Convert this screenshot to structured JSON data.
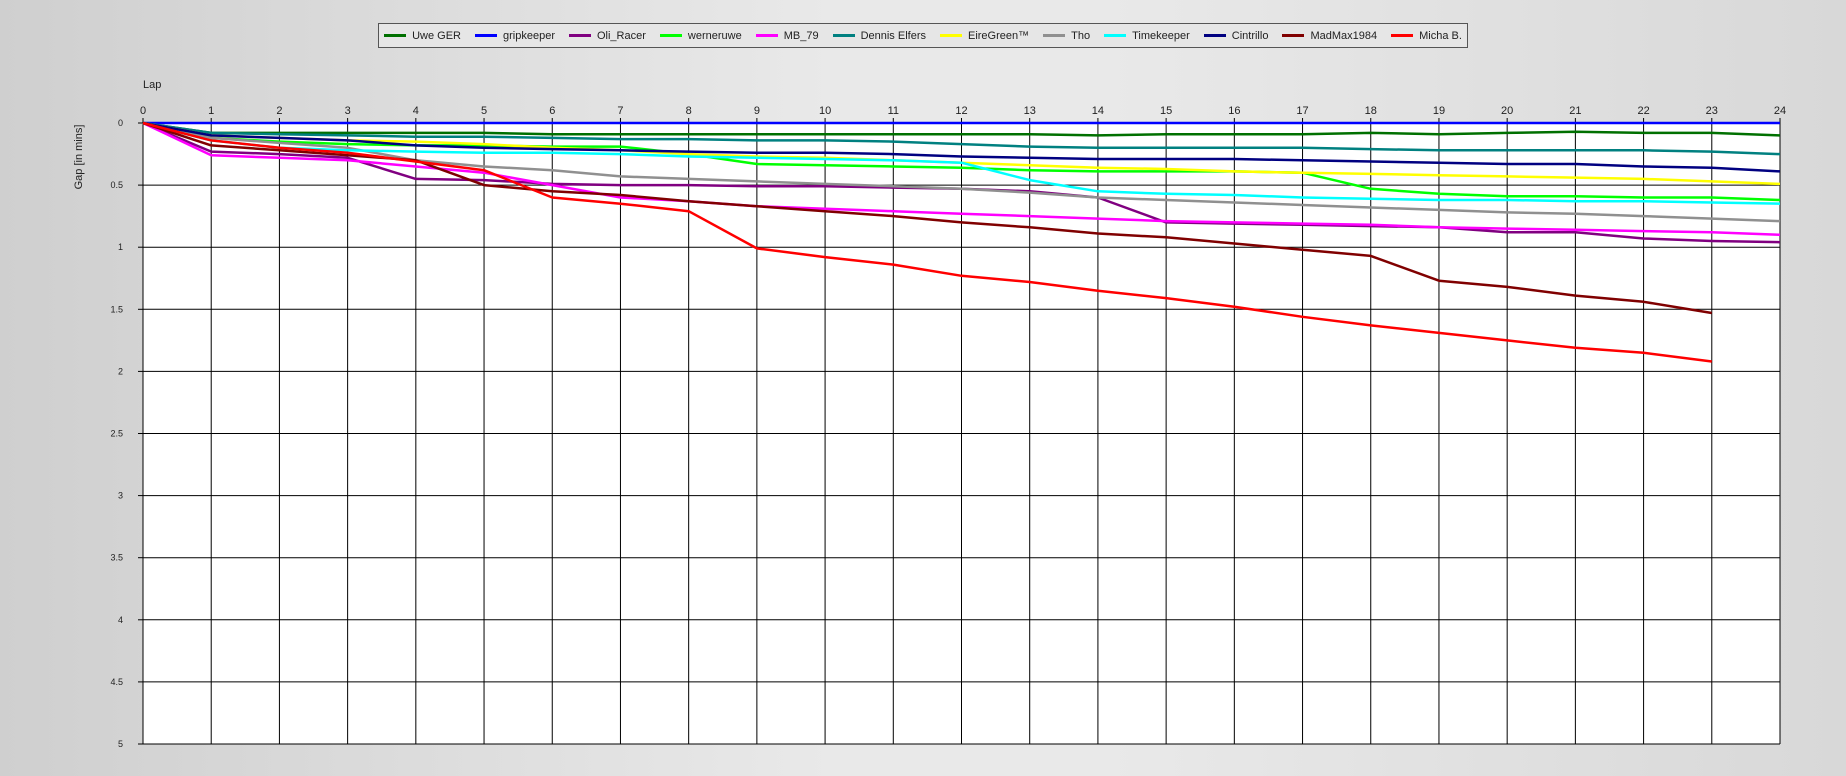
{
  "chart_data": {
    "type": "line",
    "xlabel": "Lap",
    "ylabel": "Gap [in mins]",
    "xlim": [
      0,
      24
    ],
    "ylim": [
      0,
      5
    ],
    "x_ticks": [
      0,
      1,
      2,
      3,
      4,
      5,
      6,
      7,
      8,
      9,
      10,
      11,
      12,
      13,
      14,
      15,
      16,
      17,
      18,
      19,
      20,
      21,
      22,
      23,
      24
    ],
    "y_ticks": [
      0,
      0.5,
      1,
      1.5,
      2,
      2.5,
      3,
      3.5,
      4,
      4.5,
      5
    ],
    "y_tick_labels": [
      "0",
      "0.5",
      "1",
      "1.5",
      "2",
      "2.5",
      "3",
      "3.5",
      "4",
      "4.5",
      "5"
    ],
    "y_inverted": true,
    "grid": true,
    "legend_position": "top-center",
    "series": [
      {
        "name": "Uwe GER",
        "color": "#007000",
        "values": [
          0,
          0.08,
          0.08,
          0.08,
          0.08,
          0.08,
          0.09,
          0.09,
          0.09,
          0.09,
          0.09,
          0.09,
          0.09,
          0.09,
          0.1,
          0.09,
          0.09,
          0.09,
          0.08,
          0.09,
          0.08,
          0.07,
          0.08,
          0.08,
          0.1
        ]
      },
      {
        "name": "gripkeeper",
        "color": "#0000ff",
        "values": [
          0,
          0,
          0,
          0,
          0,
          0,
          0,
          0,
          0,
          0,
          0,
          0,
          0,
          0,
          0,
          0,
          0,
          0,
          0,
          0,
          0,
          0,
          0,
          0,
          0
        ]
      },
      {
        "name": "Oli_Racer",
        "color": "#800080",
        "values": [
          0,
          0.23,
          0.25,
          0.28,
          0.45,
          0.46,
          0.49,
          0.5,
          0.5,
          0.51,
          0.51,
          0.52,
          0.53,
          0.55,
          0.6,
          0.8,
          0.81,
          0.82,
          0.83,
          0.84,
          0.88,
          0.88,
          0.93,
          0.95,
          0.96
        ]
      },
      {
        "name": "werneruwe",
        "color": "#00ff00",
        "values": [
          0,
          0.12,
          0.15,
          0.17,
          0.18,
          0.18,
          0.19,
          0.19,
          0.25,
          0.33,
          0.34,
          0.35,
          0.36,
          0.38,
          0.39,
          0.39,
          0.39,
          0.4,
          0.53,
          0.57,
          0.59,
          0.59,
          0.6,
          0.6,
          0.62
        ]
      },
      {
        "name": "MB_79",
        "color": "#ff00ff",
        "values": [
          0,
          0.26,
          0.28,
          0.3,
          0.35,
          0.4,
          0.5,
          0.6,
          0.63,
          0.67,
          0.69,
          0.71,
          0.73,
          0.75,
          0.77,
          0.79,
          0.8,
          0.81,
          0.82,
          0.84,
          0.85,
          0.86,
          0.87,
          0.88,
          0.9
        ]
      },
      {
        "name": "Dennis Elfers",
        "color": "#008080",
        "values": [
          0,
          0.08,
          0.09,
          0.1,
          0.11,
          0.11,
          0.12,
          0.13,
          0.13,
          0.14,
          0.14,
          0.15,
          0.17,
          0.19,
          0.2,
          0.2,
          0.2,
          0.2,
          0.21,
          0.22,
          0.22,
          0.22,
          0.22,
          0.23,
          0.25
        ]
      },
      {
        "name": "EireGreen™",
        "color": "#ffff00",
        "values": [
          0,
          0.1,
          0.12,
          0.14,
          0.15,
          0.17,
          0.2,
          0.22,
          0.25,
          0.27,
          0.28,
          0.3,
          0.32,
          0.34,
          0.36,
          0.37,
          0.39,
          0.4,
          0.41,
          0.42,
          0.43,
          0.44,
          0.45,
          0.47,
          0.49
        ]
      },
      {
        "name": "Tho",
        "color": "#909090",
        "values": [
          0,
          0.12,
          0.16,
          0.2,
          0.3,
          0.35,
          0.38,
          0.43,
          0.45,
          0.47,
          0.49,
          0.51,
          0.53,
          0.56,
          0.6,
          0.62,
          0.64,
          0.66,
          0.68,
          0.7,
          0.72,
          0.73,
          0.75,
          0.77,
          0.79
        ]
      },
      {
        "name": "Timekeeper",
        "color": "#00ffff",
        "values": [
          0,
          0.14,
          0.2,
          0.22,
          0.23,
          0.24,
          0.24,
          0.25,
          0.27,
          0.28,
          0.29,
          0.3,
          0.32,
          0.46,
          0.55,
          0.57,
          0.58,
          0.6,
          0.61,
          0.62,
          0.62,
          0.63,
          0.63,
          0.64,
          0.65
        ]
      },
      {
        "name": "Cintrillo",
        "color": "#000080",
        "values": [
          0,
          0.1,
          0.12,
          0.14,
          0.18,
          0.2,
          0.21,
          0.22,
          0.23,
          0.24,
          0.24,
          0.25,
          0.27,
          0.28,
          0.29,
          0.29,
          0.29,
          0.3,
          0.31,
          0.32,
          0.33,
          0.33,
          0.35,
          0.36,
          0.39
        ]
      },
      {
        "name": "MadMax1984",
        "color": "#800000",
        "values": [
          0,
          0.18,
          0.22,
          0.26,
          0.3,
          0.5,
          0.55,
          0.58,
          0.63,
          0.67,
          0.71,
          0.75,
          0.8,
          0.84,
          0.89,
          0.92,
          0.97,
          1.02,
          1.07,
          1.27,
          1.32,
          1.39,
          1.44,
          1.53,
          null
        ]
      },
      {
        "name": "Micha B.",
        "color": "#ff0000",
        "values": [
          0,
          0.14,
          0.2,
          0.24,
          0.31,
          0.38,
          0.6,
          0.65,
          0.71,
          1.01,
          1.08,
          1.14,
          1.23,
          1.28,
          1.35,
          1.41,
          1.48,
          1.56,
          1.63,
          1.69,
          1.75,
          1.81,
          1.85,
          1.92,
          null
        ]
      }
    ]
  }
}
